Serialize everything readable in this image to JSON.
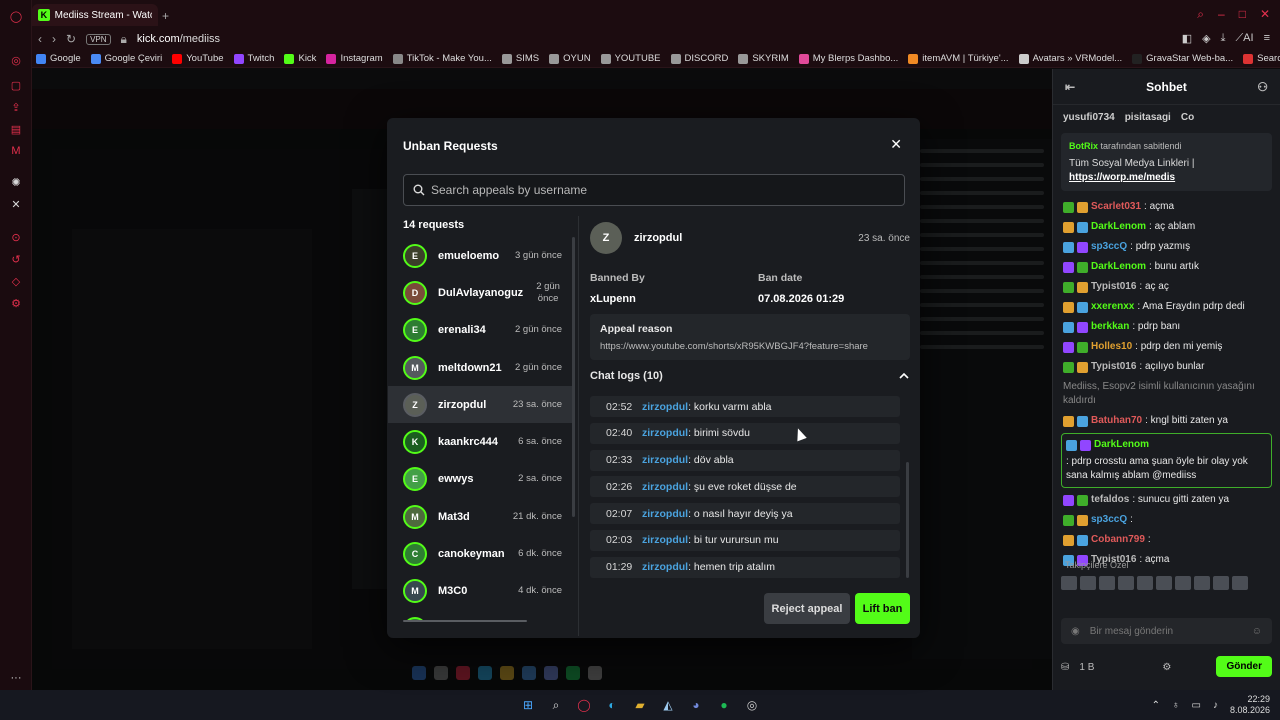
{
  "browser": {
    "tab_title": "Mediiss Stream - Watch Liv",
    "vpn_label": "VPN",
    "url_host": "kick.com",
    "url_path": "/mediiss",
    "bookmarks": [
      {
        "label": "Google",
        "color": "#4285f4"
      },
      {
        "label": "Google Çeviri",
        "color": "#4a8af4"
      },
      {
        "label": "YouTube",
        "color": "#ff0000"
      },
      {
        "label": "Twitch",
        "color": "#9146ff"
      },
      {
        "label": "Kick",
        "color": "#53fc18"
      },
      {
        "label": "Instagram",
        "color": "#d6249f"
      },
      {
        "label": "TikTok - Make You...",
        "color": "#888888"
      },
      {
        "label": "SIMS",
        "color": "#999999"
      },
      {
        "label": "OYUN",
        "color": "#999999"
      },
      {
        "label": "YOUTUBE",
        "color": "#999999"
      },
      {
        "label": "DISCORD",
        "color": "#999999"
      },
      {
        "label": "SKYRIM",
        "color": "#999999"
      },
      {
        "label": "My Blerps Dashbo...",
        "color": "#e14a9a"
      },
      {
        "label": "itemAVM | Türkiye'...",
        "color": "#f08a24"
      },
      {
        "label": "Avatars » VRModel...",
        "color": "#cccccc"
      },
      {
        "label": "GravaStar Web-ba...",
        "color": "#222222"
      },
      {
        "label": "Search | RipperSto...",
        "color": "#d33"
      }
    ],
    "ai_label": "AI"
  },
  "modal": {
    "title": "Unban Requests",
    "search_placeholder": "Search appeals by username",
    "count_label": "14 requests",
    "requests": [
      {
        "name": "emueloemo",
        "time": "3 gün önce",
        "initial": "E",
        "color": "#3b3f2a"
      },
      {
        "name": "DulAvlayanoguz",
        "time": "2 gün önce",
        "initial": "D",
        "color": "#7a4b3a"
      },
      {
        "name": "erenali34",
        "time": "2 gün önce",
        "initial": "E",
        "color": "#2e7d32"
      },
      {
        "name": "meltdown21",
        "time": "2 gün önce",
        "initial": "M",
        "color": "#555a5e"
      },
      {
        "name": "zirzopdul",
        "time": "23 sa. önce",
        "initial": "Z",
        "color": "#5b5f57"
      },
      {
        "name": "kaankrc444",
        "time": "6 sa. önce",
        "initial": "K",
        "color": "#1b5e20"
      },
      {
        "name": "ewwys",
        "time": "2 sa. önce",
        "initial": "E",
        "color": "#43a047"
      },
      {
        "name": "Mat3d",
        "time": "21 dk. önce",
        "initial": "M",
        "color": "#4e6a3d"
      },
      {
        "name": "canokeyman",
        "time": "6 dk. önce",
        "initial": "C",
        "color": "#2e7d32"
      },
      {
        "name": "M3C0",
        "time": "4 dk. önce",
        "initial": "M",
        "color": "#37474f"
      },
      {
        "name": "",
        "time": "3",
        "initial": "",
        "color": "#2e7d32"
      }
    ],
    "selected": {
      "name": "zirzopdul",
      "time": "23 sa. önce",
      "initial": "Z",
      "banned_by_label": "Banned By",
      "banned_by": "xLupenn",
      "ban_date_label": "Ban date",
      "ban_date": "07.08.2026 01:29",
      "appeal_label": "Appeal reason",
      "appeal_text": "https://www.youtube.com/shorts/xR95KWBGJF4?feature=share",
      "logs_label": "Chat logs (10)",
      "logs": [
        {
          "time": "02:52",
          "user": "zirzopdul",
          "text": ": korku varmı abla"
        },
        {
          "time": "02:40",
          "user": "zirzopdul",
          "text": ": birimi sövdu"
        },
        {
          "time": "02:33",
          "user": "zirzopdul",
          "text": ": döv abla"
        },
        {
          "time": "02:26",
          "user": "zirzopdul",
          "text": ": şu eve roket düşse de"
        },
        {
          "time": "02:07",
          "user": "zirzopdul",
          "text": ": o nasıl hayır deyiş ya"
        },
        {
          "time": "02:03",
          "user": "zirzopdul",
          "text": ": bi tur vurursun mu"
        },
        {
          "time": "01:29",
          "user": "zirzopdul",
          "text": ": hemen trip atalım"
        }
      ]
    },
    "reject_label": "Reject appeal",
    "lift_label": "Lift ban"
  },
  "chat": {
    "title": "Sohbet",
    "gifters": [
      "yusufi0734",
      "pisitasagi",
      "Co"
    ],
    "pinned_by": "BotRix",
    "pinned_suffix": " tarafından sabitlendi",
    "pinned_text": "Tüm Sosyal Medya Linkleri |",
    "pinned_link": "https://worp.me/medis",
    "messages": [
      {
        "user": "Scarlet031",
        "color": "#e05a5a",
        "text": ": açma",
        "hl": false
      },
      {
        "user": "DarkLenom",
        "color": "#53fc18",
        "text": ": aç ablam",
        "hl": false
      },
      {
        "user": "sp3ccQ",
        "color": "#4aa3df",
        "text": ": pdrp yazmış",
        "hl": false
      },
      {
        "user": "DarkLenom",
        "color": "#53fc18",
        "text": ": bunu artık",
        "hl": false
      },
      {
        "user": "Typist016",
        "color": "#bbbbbb",
        "text": ": aç aç",
        "hl": false
      },
      {
        "user": "xxerenxx",
        "color": "#53fc18",
        "text": ": Ama Eraydın pdrp dedi",
        "hl": false
      },
      {
        "user": "berkkan",
        "color": "#53fc18",
        "text": ": pdrp banı",
        "hl": false
      },
      {
        "user": "Holles10",
        "color": "#e0a030",
        "text": ": pdrp den mi yemiş",
        "hl": false
      },
      {
        "user": "Typist016",
        "color": "#bbbbbb",
        "text": ": açılıyo bunlar",
        "hl": false
      },
      {
        "user": "Batuhan70",
        "color": "#e05a5a",
        "text": ": kngl bitti zaten ya",
        "hl": false
      },
      {
        "user": "DarkLenom",
        "color": "#53fc18",
        "text": ": pdrp crosstu ama şuan öyle bir olay yok sana kalmış ablam @mediiss",
        "hl": true
      },
      {
        "user": "tefaldos",
        "color": "#bbbbbb",
        "text": ": sunucu gitti zaten ya",
        "hl": false
      },
      {
        "user": "sp3ccQ",
        "color": "#4aa3df",
        "text": ":",
        "hl": false
      },
      {
        "user": "Cobann799",
        "color": "#e05a5a",
        "text": ":",
        "hl": false
      },
      {
        "user": "Typist016",
        "color": "#bbbbbb",
        "text": ": açma",
        "hl": false
      }
    ],
    "system_msg": "Mediiss, Esopv2 isimli kullanıcının yasağını kaldırdı",
    "emote_label": "Takipçilere Özel",
    "input_placeholder": "Bir mesaj gönderin",
    "balance": "1 B",
    "send_label": "Gönder"
  },
  "taskbar": {
    "time": "22:29",
    "date": "8.08.2026"
  }
}
